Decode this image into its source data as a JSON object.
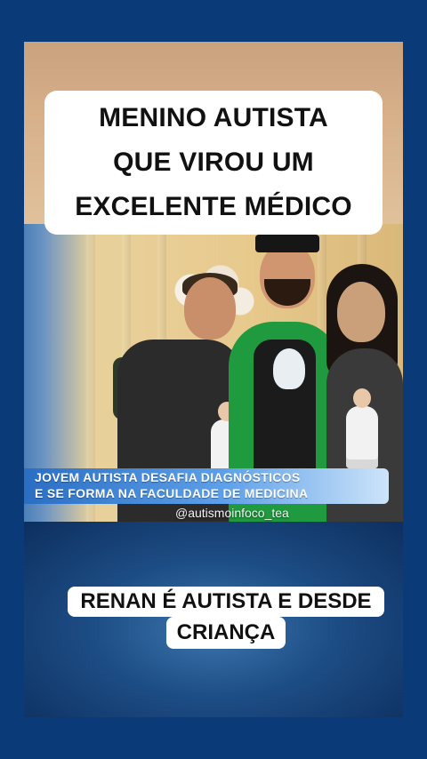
{
  "title": {
    "lines": [
      "MENINO AUTISTA",
      "QUE VIROU UM",
      "EXCELENTE MÉDICO"
    ]
  },
  "news_banner": {
    "line1": "JOVEM AUTISTA DESAFIA DIAGNÓSTICOS",
    "line2": "E SE FORMA NA FACULDADE DE MEDICINA"
  },
  "watermark": "@autismoinfoco_tea",
  "caption": {
    "line1": "RENAN É AUTISTA E DESDE",
    "line2": "CRIANÇA"
  },
  "colors": {
    "page_background": "#0b3a78",
    "banner_blue": "#2a6ec4",
    "gown_green": "#1f9a3e"
  }
}
